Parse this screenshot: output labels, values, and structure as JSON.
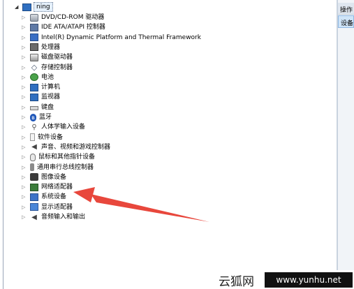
{
  "tree": {
    "root_label": "ning",
    "items": [
      {
        "label": "DVD/CD-ROM 驱动器",
        "icon": "cd-drive-icon",
        "cls": "i-cd"
      },
      {
        "label": "IDE ATA/ATAPI 控制器",
        "icon": "ide-controller-icon",
        "cls": "i-ide"
      },
      {
        "label": "Intel(R) Dynamic Platform and Thermal Framework",
        "icon": "intel-device-icon",
        "cls": "i-intel"
      },
      {
        "label": "处理器",
        "icon": "processor-icon",
        "cls": "i-cpu"
      },
      {
        "label": "磁盘驱动器",
        "icon": "disk-drive-icon",
        "cls": "i-disk"
      },
      {
        "label": "存储控制器",
        "icon": "storage-controller-icon",
        "cls": "i-storage",
        "glyph": "◇"
      },
      {
        "label": "电池",
        "icon": "battery-icon",
        "cls": "i-battery"
      },
      {
        "label": "计算机",
        "icon": "computer-icon",
        "cls": "i-monitor"
      },
      {
        "label": "监视器",
        "icon": "monitor-icon",
        "cls": "i-monitor"
      },
      {
        "label": "键盘",
        "icon": "keyboard-icon",
        "cls": "i-keyboard"
      },
      {
        "label": "蓝牙",
        "icon": "bluetooth-icon",
        "cls": "i-bt",
        "glyph": "ʙ"
      },
      {
        "label": "人体学输入设备",
        "icon": "hid-icon",
        "cls": "i-hid",
        "glyph": "⚲"
      },
      {
        "label": "软件设备",
        "icon": "software-device-icon",
        "cls": "i-soft"
      },
      {
        "label": "声音、视频和游戏控制器",
        "icon": "sound-icon",
        "cls": "i-sound",
        "glyph": "◀"
      },
      {
        "label": "鼠标和其他指针设备",
        "icon": "mouse-icon",
        "cls": "i-mouse"
      },
      {
        "label": "通用串行总线控制器",
        "icon": "usb-icon",
        "cls": "i-usb"
      },
      {
        "label": "图像设备",
        "icon": "camera-icon",
        "cls": "i-cam"
      },
      {
        "label": "网络适配器",
        "icon": "network-adapter-icon",
        "cls": "i-net"
      },
      {
        "label": "系统设备",
        "icon": "system-device-icon",
        "cls": "i-sys"
      },
      {
        "label": "显示适配器",
        "icon": "display-adapter-icon",
        "cls": "i-display"
      },
      {
        "label": "音频输入和输出",
        "icon": "audio-io-icon",
        "cls": "i-audio",
        "glyph": "◀"
      }
    ]
  },
  "actions": {
    "header": "操作",
    "item": "设备"
  },
  "watermark": {
    "site_cn": "云狐网",
    "url": "www.yunhu.net"
  },
  "colors": {
    "arrow": "#e8473c",
    "selection_bg": "#e5f0fb",
    "action_selected": "#cfe4f8"
  }
}
